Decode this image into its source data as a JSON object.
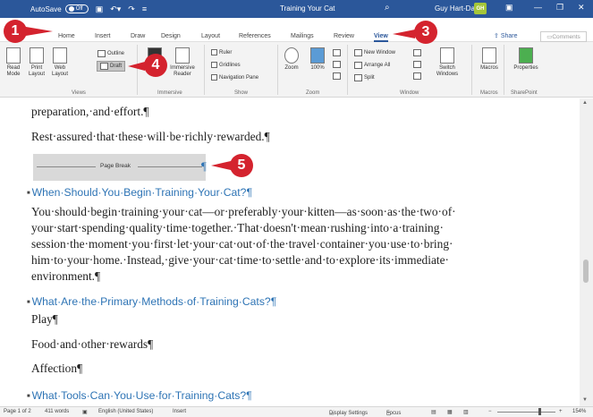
{
  "titlebar": {
    "autosave_label": "AutoSave",
    "autosave_state": "Off",
    "document_title": "Training Your Cat",
    "user_name": "Guy Hart-Davis",
    "user_initials": "GH"
  },
  "tabs": [
    {
      "label": "Home"
    },
    {
      "label": "Insert"
    },
    {
      "label": "Draw"
    },
    {
      "label": "Design"
    },
    {
      "label": "Layout"
    },
    {
      "label": "References"
    },
    {
      "label": "Mailings"
    },
    {
      "label": "Review"
    },
    {
      "label": "View"
    }
  ],
  "share_label": "Share",
  "comments_label": "Comments",
  "ribbon": {
    "views": {
      "read_mode": "Read Mode",
      "print_layout": "Print Layout",
      "web_layout": "Web Layout",
      "outline": "Outline",
      "draft": "Draft",
      "group": "Views"
    },
    "immersive": {
      "focus": "Focus",
      "reader": "Immersive Reader",
      "group": "Immersive"
    },
    "show": {
      "ruler": "Ruler",
      "gridlines": "Gridlines",
      "nav_pane": "Navigation Pane",
      "group": "Show"
    },
    "zoom": {
      "zoom": "Zoom",
      "hundred": "100%",
      "group": "Zoom"
    },
    "window": {
      "new_window": "New Window",
      "arrange_all": "Arrange All",
      "split": "Split",
      "switch_windows": "Switch Windows",
      "group": "Window"
    },
    "macros": {
      "label": "Macros",
      "group": "Macros"
    },
    "sharepoint": {
      "label": "Properties",
      "group": "SharePoint"
    }
  },
  "document": {
    "p1": "preparation,·and·effort.¶",
    "p2": "Rest·assured·that·these·will·be·richly·rewarded.¶",
    "page_break": "Page Break",
    "h1": "When·Should·You·Begin·Training·Your·Cat?¶",
    "b1": [
      "You·should·begin·training·your·cat—or·preferably·your·kitten—as·soon·as·the·two·of·",
      "your·start·spending·quality·time·together.·That·doesn't·mean·rushing·into·a·training·",
      "session·the·moment·you·first·let·your·cat·out·of·the·travel·container·you·use·to·bring·",
      "him·to·your·home.·Instead,·give·your·cat·time·to·settle·and·to·explore·its·immediate·",
      "environment.¶"
    ],
    "h2": "What·Are·the·Primary·Methods·of·Training·Cats?¶",
    "items": [
      "Play¶",
      "Food·and·other·rewards¶",
      "Affection¶"
    ],
    "h3": "What·Tools·Can·You·Use·for·Training·Cats?¶"
  },
  "statusbar": {
    "page": "Page 1 of 2",
    "words": "411 words",
    "language": "English (United States)",
    "mode": "Insert",
    "display_settings": "Display Settings",
    "focus": "Focus",
    "zoom": "154%"
  },
  "callouts": [
    "1",
    "3",
    "4",
    "5"
  ],
  "colors": {
    "title_blue": "#2b579a",
    "heading_blue": "#2e74b5",
    "callout_red": "#d4232e"
  }
}
